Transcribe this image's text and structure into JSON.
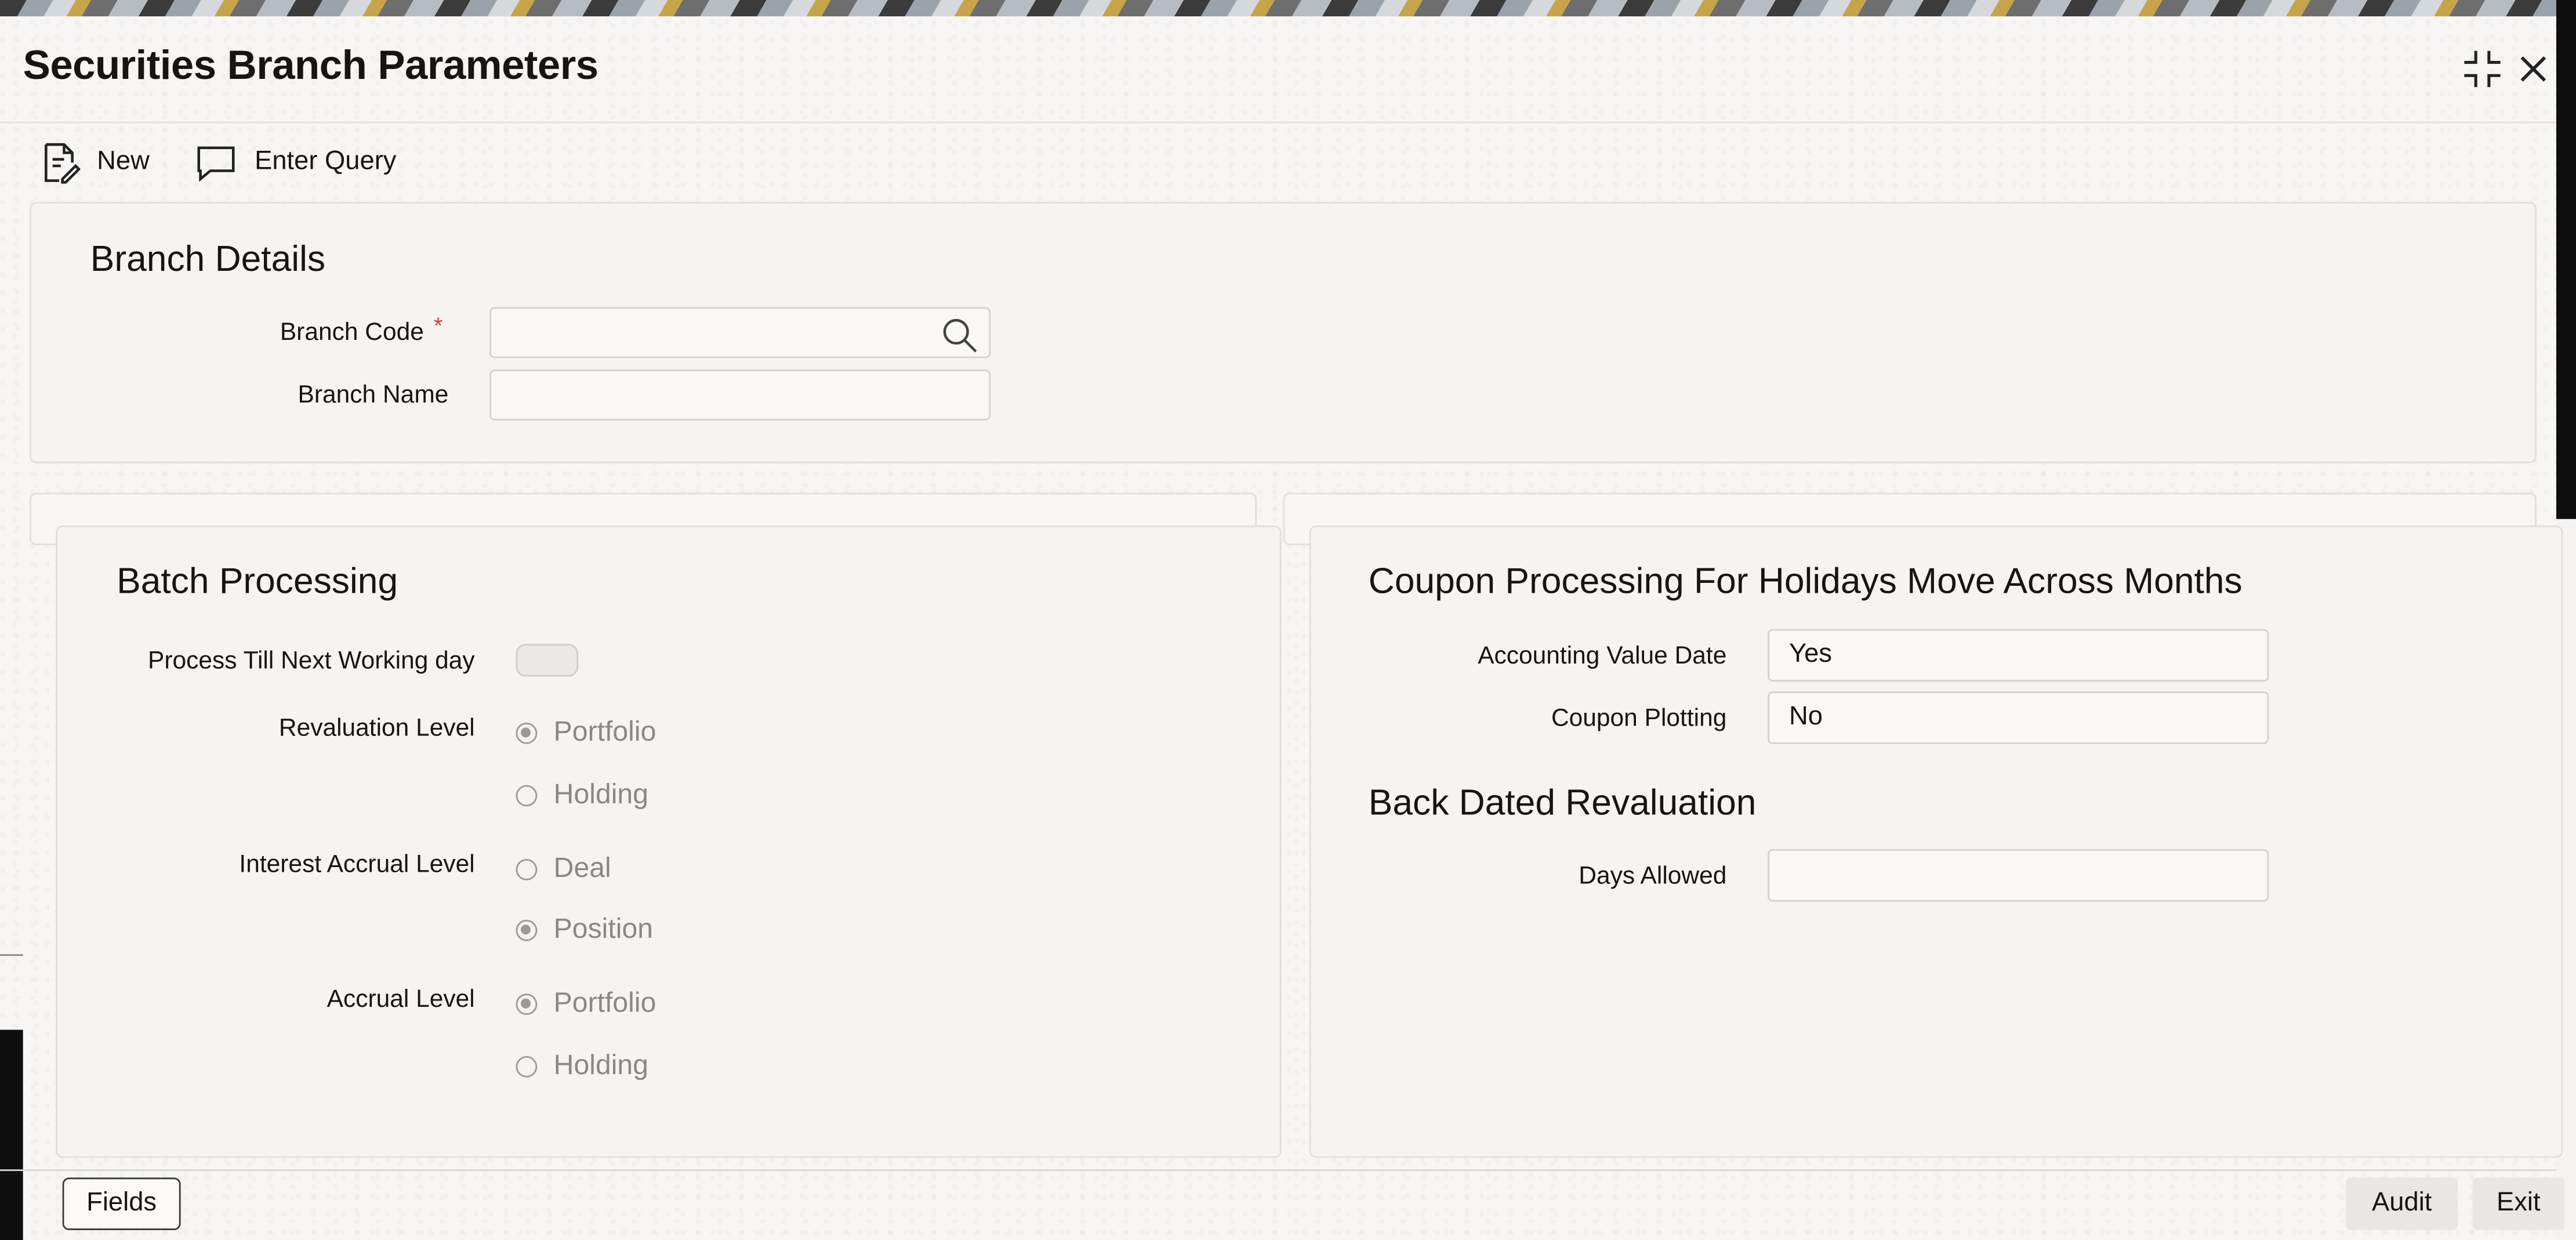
{
  "window": {
    "title": "Securities Branch Parameters"
  },
  "toolbar": {
    "new_label": "New",
    "enter_query_label": "Enter Query"
  },
  "branch_details": {
    "heading": "Branch Details",
    "branch_code_label": "Branch Code",
    "required_marker": "*",
    "branch_code_value": "",
    "branch_name_label": "Branch Name",
    "branch_name_value": ""
  },
  "batch_processing": {
    "heading": "Batch Processing",
    "process_till_label": "Process Till Next Working day",
    "process_till_on": false,
    "revaluation_level_label": "Revaluation Level",
    "revaluation_options": [
      "Portfolio",
      "Holding"
    ],
    "revaluation_selected": "Portfolio",
    "interest_accrual_label": "Interest Accrual Level",
    "interest_accrual_options": [
      "Deal",
      "Position"
    ],
    "interest_accrual_selected": "Position",
    "accrual_level_label": "Accrual Level",
    "accrual_options": [
      "Portfolio",
      "Holding"
    ],
    "accrual_selected": "Portfolio"
  },
  "coupon_processing": {
    "heading": "Coupon Processing For Holidays Move Across Months",
    "accounting_value_date_label": "Accounting Value Date",
    "accounting_value_date_value": "Yes",
    "coupon_plotting_label": "Coupon Plotting",
    "coupon_plotting_value": "No"
  },
  "back_dated_revaluation": {
    "heading": "Back Dated Revaluation",
    "days_allowed_label": "Days Allowed",
    "days_allowed_value": ""
  },
  "footer": {
    "fields_label": "Fields",
    "audit_label": "Audit",
    "exit_label": "Exit"
  }
}
